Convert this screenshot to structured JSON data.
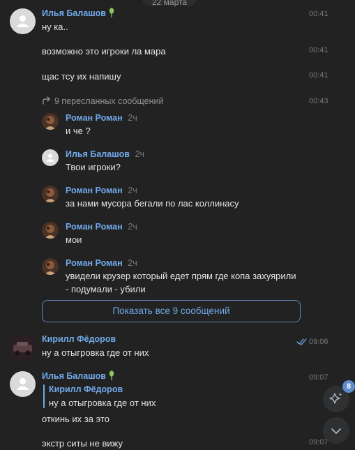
{
  "date_pill": "22 марта",
  "messages": [
    {
      "author": "Илья Балашов",
      "text": "ну ка..",
      "time": "00:41"
    },
    {
      "text": "возможно это игроки ла мара",
      "time": "00:41"
    },
    {
      "text": "щас тсу их напишу",
      "time": "00:41"
    }
  ],
  "forward": {
    "label": "9 пересланных сообщений",
    "time": "00:43",
    "items": [
      {
        "author": "Роман Роман",
        "rel": "2ч",
        "text": "и че ?"
      },
      {
        "author": "Илья Балашов",
        "rel": "2ч",
        "text": "Твои игроки?"
      },
      {
        "author": "Роман Роман",
        "rel": "2ч",
        "text": "за нами мусора бегали по лас коллинасу"
      },
      {
        "author": "Роман Роман",
        "rel": "2ч",
        "text": "мои"
      },
      {
        "author": "Роман Роман",
        "rel": "2ч",
        "text_line1": "увидели крузер который едет прям где копа захуярили",
        "text_line2": "- подумали - убили"
      }
    ],
    "show_all": "Показать все 9 сообщений"
  },
  "kirill": {
    "author": "Кирилл Фёдоров",
    "text": "ну а отыгровка где от них",
    "time": "09:06"
  },
  "ilya2": {
    "author": "Илья Балашов",
    "time": "09:07",
    "reply_author": "Кирилл Фёдоров",
    "reply_text": "ну а отыгровка где от них",
    "text1": "откинь их за это",
    "text2": "экстр ситы не вижу",
    "time2": "09:07"
  },
  "fab_badge": "8",
  "colors": {
    "background": "#222222",
    "name": "#71aaeb",
    "text": "#e1e3e6",
    "time": "#76787a",
    "accent": "#5d8ecb"
  }
}
